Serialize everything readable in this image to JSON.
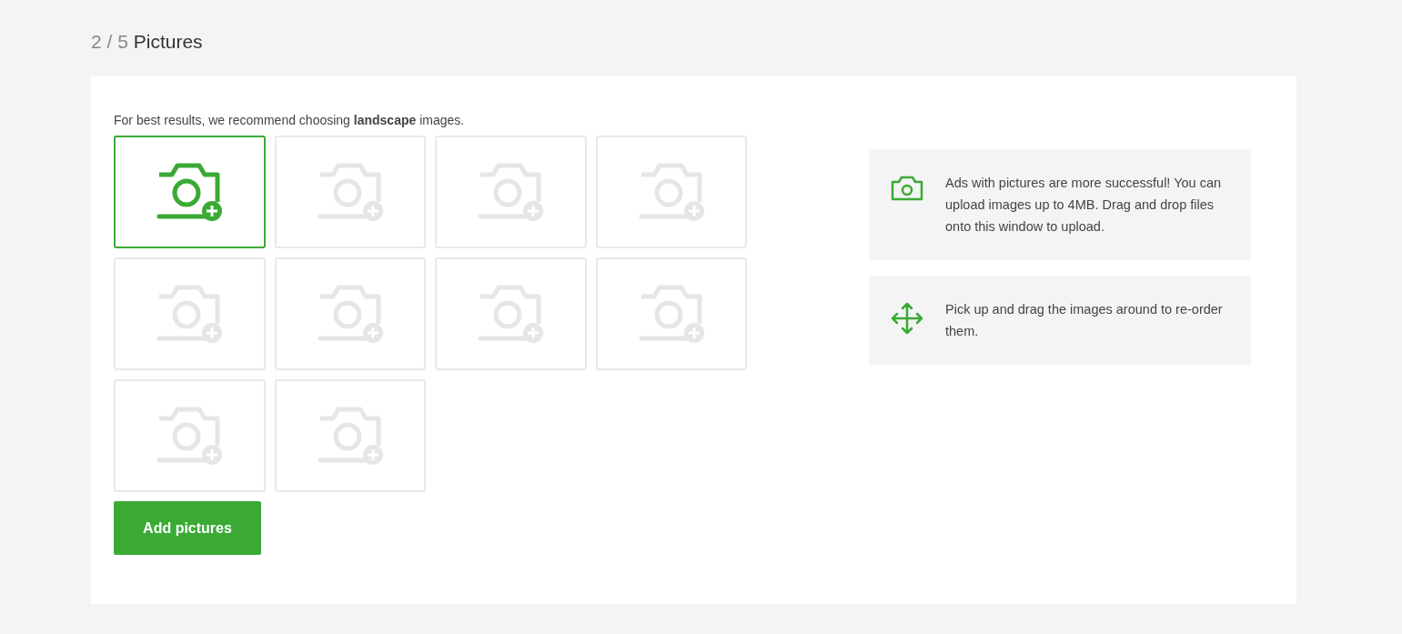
{
  "header": {
    "count": "2 / 5",
    "title": "Pictures"
  },
  "hint": "For best results, we recommend choosing **landscape** images.",
  "slots": [
    {
      "selected": true
    },
    {
      "selected": false
    },
    {
      "selected": false
    },
    {
      "selected": false
    },
    {
      "selected": false
    },
    {
      "selected": false
    },
    {
      "selected": false
    },
    {
      "selected": false
    },
    {
      "selected": false
    },
    {
      "selected": false
    }
  ],
  "add_button": "Add pictures",
  "tips": [
    {
      "kind": "camera",
      "text": "Ads with pictures are more successful! You can upload images up to 4MB. Drag and drop files onto this window to upload."
    },
    {
      "kind": "move",
      "text": "Pick up and drag the images around to re-order them."
    }
  ]
}
